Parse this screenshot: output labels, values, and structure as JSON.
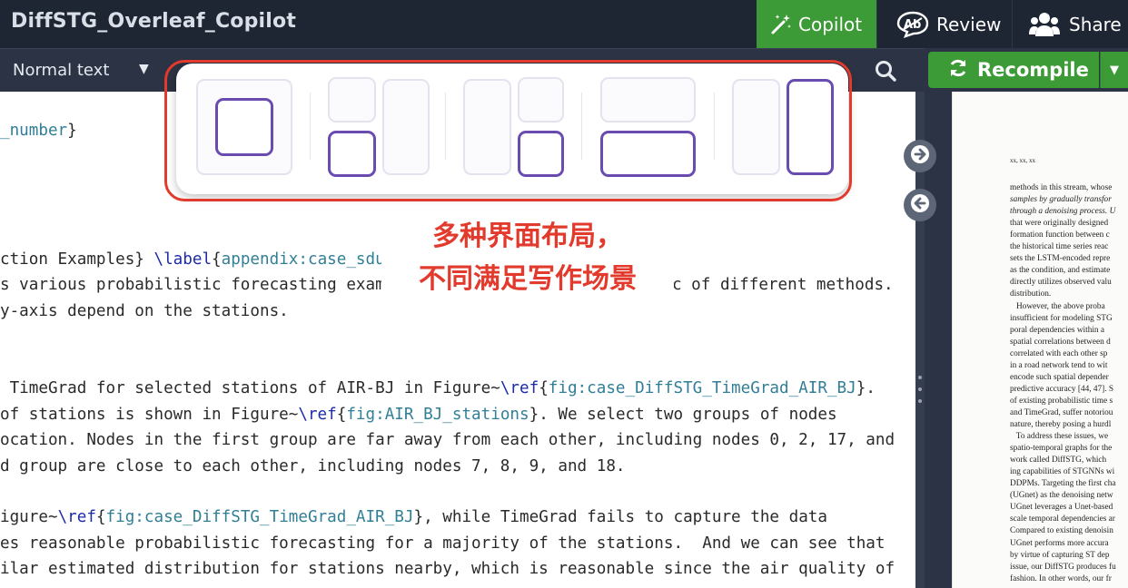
{
  "header": {
    "project_title": "DiffSTG_Overleaf_Copilot",
    "copilot_label": "Copilot",
    "review_label": "Review",
    "share_label": "Share",
    "accent_color": "#3c9a37"
  },
  "toolbar": {
    "text_style": "Normal text",
    "recompile_label": "Recompile"
  },
  "icons": {
    "copilot": "magic-wand-icon",
    "review": "review-icon",
    "share": "users-icon",
    "search": "search-icon",
    "recompile": "refresh-icon"
  },
  "editor": {
    "lines": [
      {
        "segments": [
          {
            "t": "arg",
            "v": "_number"
          },
          {
            "t": "txt",
            "v": "}"
          }
        ]
      },
      {
        "segments": [
          {
            "t": "txt",
            "v": "ction Examples} "
          },
          {
            "t": "kw",
            "v": "\\label"
          },
          {
            "t": "txt",
            "v": "{"
          },
          {
            "t": "arg",
            "v": "appendix:case_sdu"
          }
        ]
      },
      {
        "segments": [
          {
            "t": "txt",
            "v": "s various probabilistic forecasting exam"
          }
        ]
      },
      {
        "segments": [
          {
            "t": "txt",
            "v": "c of different methods."
          }
        ]
      },
      {
        "segments": [
          {
            "t": "txt",
            "v": "y-axis depend on the stations."
          }
        ]
      },
      {
        "segments": [
          {
            "t": "txt",
            "v": " TimeGrad for selected stations of AIR-BJ in Figure~"
          },
          {
            "t": "kw",
            "v": "\\ref"
          },
          {
            "t": "txt",
            "v": "{"
          },
          {
            "t": "arg",
            "v": "fig:case_DiffSTG_TimeGrad_AIR_BJ"
          },
          {
            "t": "txt",
            "v": "}."
          }
        ]
      },
      {
        "segments": [
          {
            "t": "txt",
            "v": "of stations is shown in Figure~"
          },
          {
            "t": "kw",
            "v": "\\ref"
          },
          {
            "t": "txt",
            "v": "{"
          },
          {
            "t": "arg",
            "v": "fig:AIR_BJ_stations"
          },
          {
            "t": "txt",
            "v": "}. We select two groups of nodes"
          }
        ]
      },
      {
        "segments": [
          {
            "t": "txt",
            "v": "ocation. Nodes in the first group are far away from each other, including nodes 0, 2, 17, and"
          }
        ]
      },
      {
        "segments": [
          {
            "t": "txt",
            "v": "d group are close to each other, including nodes 7, 8, 9, and 18."
          }
        ]
      },
      {
        "segments": [
          {
            "t": "txt",
            "v": "igure~"
          },
          {
            "t": "kw",
            "v": "\\ref"
          },
          {
            "t": "txt",
            "v": "{"
          },
          {
            "t": "arg",
            "v": "fig:case_DiffSTG_TimeGrad_AIR_BJ"
          },
          {
            "t": "txt",
            "v": "}, while TimeGrad fails to capture the data"
          }
        ]
      },
      {
        "segments": [
          {
            "t": "txt",
            "v": "es reasonable probabilistic forecasting for a majority of the stations.  And we can see that"
          }
        ]
      },
      {
        "segments": [
          {
            "t": "txt",
            "v": "ilar estimated distribution for stations nearby, which is reasonable since the air quality of"
          }
        ]
      }
    ]
  },
  "pdf": {
    "header_text": "xx, xx, xx",
    "lines": [
      {
        "v": "methods in this stream, whose"
      },
      {
        "v": "samples by gradually transfor",
        "it": true
      },
      {
        "v": "through a denoising process. U",
        "it": true
      },
      {
        "v": "that were originally designed"
      },
      {
        "v": "formation function between c"
      },
      {
        "v": "the historical time series reac"
      },
      {
        "v": "sets the LSTM-encoded repre"
      },
      {
        "v": "as the condition, and estimate"
      },
      {
        "v": "directly utilizes observed valu"
      },
      {
        "v": "distribution."
      },
      {
        "v": "   However, the above proba"
      },
      {
        "v": "insufficient for modeling STG"
      },
      {
        "v": "poral dependencies within a"
      },
      {
        "v": "spatial correlations between d"
      },
      {
        "v": "correlated with each other sp"
      },
      {
        "v": "in a road network tend to wit"
      },
      {
        "v": "encode such spatial depender"
      },
      {
        "v": "predictive accuracy [44, 47]. S"
      },
      {
        "v": "of existing probabilistic time s"
      },
      {
        "v": "and TimeGrad, suffer notoriou"
      },
      {
        "v": "nature, thereby posing a hurdl"
      },
      {
        "v": "   To address these issues, we"
      },
      {
        "v": "spatio-temporal graphs for the"
      },
      {
        "v": "work called DiffSTG, which"
      },
      {
        "v": "ing capabilities of STGNNs wi"
      },
      {
        "v": "DDPMs. Targeting the first cha"
      },
      {
        "v": "(UGnet) as the denoising netw"
      },
      {
        "v": "UGnet leverages a Unet-based"
      },
      {
        "v": "scale temporal dependencies ar"
      },
      {
        "v": "Compared to existing denoisin"
      },
      {
        "v": "UGnet performs more accura"
      },
      {
        "v": "by virtue of capturing ST dep"
      },
      {
        "v": "issue, our DiffSTG produces fu"
      },
      {
        "v": "fashion. In other words, our fr"
      }
    ]
  },
  "annotation": {
    "line1": "多种界面布局，",
    "line2": "不同满足写作场景",
    "color": "#e23a2c"
  }
}
